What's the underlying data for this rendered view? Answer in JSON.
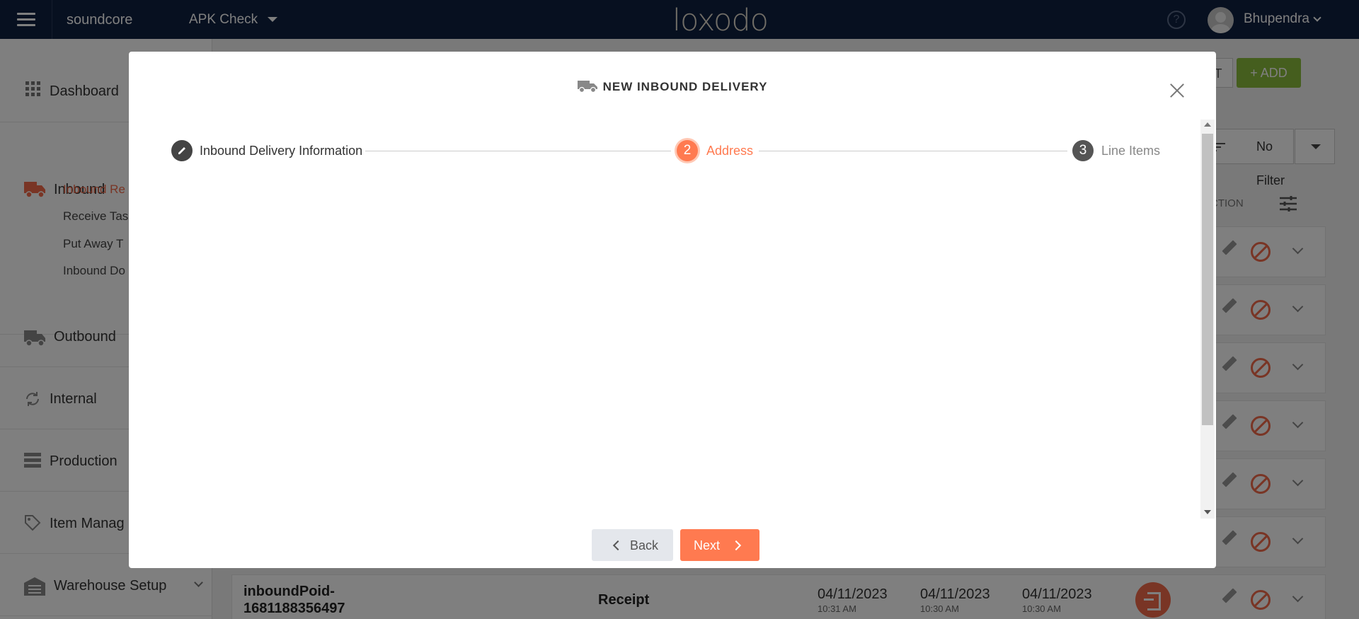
{
  "topbar": {
    "tenant": "soundcore",
    "warehouse": "APK Check",
    "logo": "loxodo",
    "help_glyph": "?",
    "user_name": "Bhupendra"
  },
  "sidebar": {
    "items": [
      {
        "label": "Dashboard",
        "icon": "grid-icon"
      },
      {
        "label": "Inbound",
        "icon": "truck-icon"
      },
      {
        "label": "Outbound",
        "icon": "truck-icon"
      },
      {
        "label": "Internal",
        "icon": "refresh-icon"
      },
      {
        "label": "Production",
        "icon": "server-icon"
      },
      {
        "label": "Item Manag",
        "icon": "tag-icon"
      },
      {
        "label": "Warehouse Setup",
        "icon": "warehouse-icon"
      }
    ],
    "inbound_sub": [
      "Inbound Re",
      "Receive Tas",
      "Put Away T",
      "Inbound Do"
    ]
  },
  "main": {
    "partial_button": "T",
    "add_button": "ADD",
    "filter": "No Filter",
    "action_header": "ACTION",
    "last_row": {
      "poid_line1": "inboundPoid-",
      "poid_line2": "1681188356497",
      "type": "Receipt",
      "dates": [
        {
          "date": "04/11/2023",
          "time": "10:31 AM"
        },
        {
          "date": "04/11/2023",
          "time": "10:30 AM"
        },
        {
          "date": "04/11/2023",
          "time": "10:30 AM"
        }
      ]
    }
  },
  "modal": {
    "title": "NEW INBOUND DELIVERY",
    "steps": [
      {
        "number": "",
        "label": "Inbound Delivery Information",
        "state": "completed"
      },
      {
        "number": "2",
        "label": "Address",
        "state": "active"
      },
      {
        "number": "3",
        "label": "Line Items",
        "state": "pending"
      }
    ],
    "back_button": "Back",
    "next_button": "Next"
  },
  "colors": {
    "topbar": "#0f2040",
    "accent": "#ff7a50",
    "add_green": "#8bbd3d"
  }
}
